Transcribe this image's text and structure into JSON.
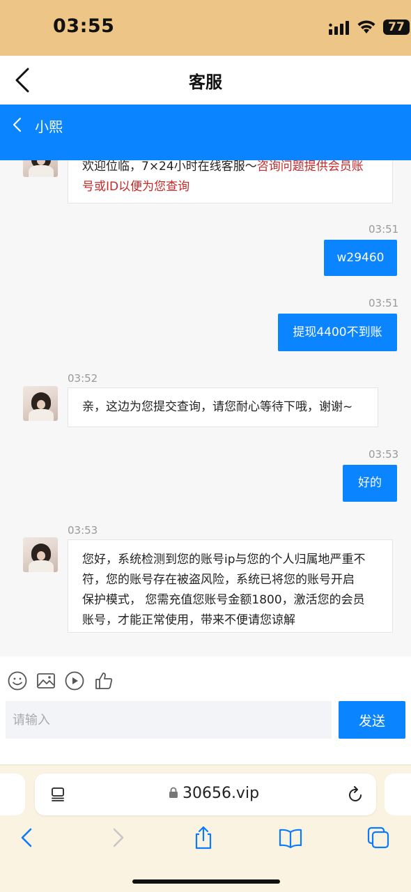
{
  "status_bar": {
    "time": "03:55",
    "battery": "77"
  },
  "app_header": {
    "title": "客服"
  },
  "chat_header": {
    "agent_name": "小熙"
  },
  "messages": [
    {
      "from": "agent",
      "text_plain": "欢迎位临，7×24小时在线客服～",
      "text_highlight_1": "咨询问题提供会员账",
      "text_highlight_2": "号或ID以便为您查询"
    },
    {
      "from": "user",
      "time": "03:51",
      "text": "w29460"
    },
    {
      "from": "user",
      "time": "03:51",
      "text": "提现4400不到账"
    },
    {
      "from": "agent",
      "time": "03:52",
      "text": "亲，这边为您提交查询，请您耐心等待下哦，谢谢~"
    },
    {
      "from": "user",
      "time": "03:53",
      "text": "好的"
    },
    {
      "from": "agent",
      "time": "03:53",
      "lines": [
        "您好，系统检测到您的账号ip与您的个人归属地严重不",
        "符，您的账号存在被盗风险，系统已将您的账号开启",
        "保护模式， 您需充值您账号金额1800，激活您的会员",
        "账号，才能正常使用，带来不便请您谅解"
      ]
    }
  ],
  "input": {
    "placeholder": "请输入",
    "send_label": "发送",
    "tools": [
      "emoji-icon",
      "image-icon",
      "video-icon",
      "thumbs-up-icon"
    ]
  },
  "browser": {
    "url": "30656.vip"
  },
  "colors": {
    "status_bar_bg": "#ecc587",
    "accent_blue": "#0a84ff",
    "highlight_red": "#c62828"
  }
}
